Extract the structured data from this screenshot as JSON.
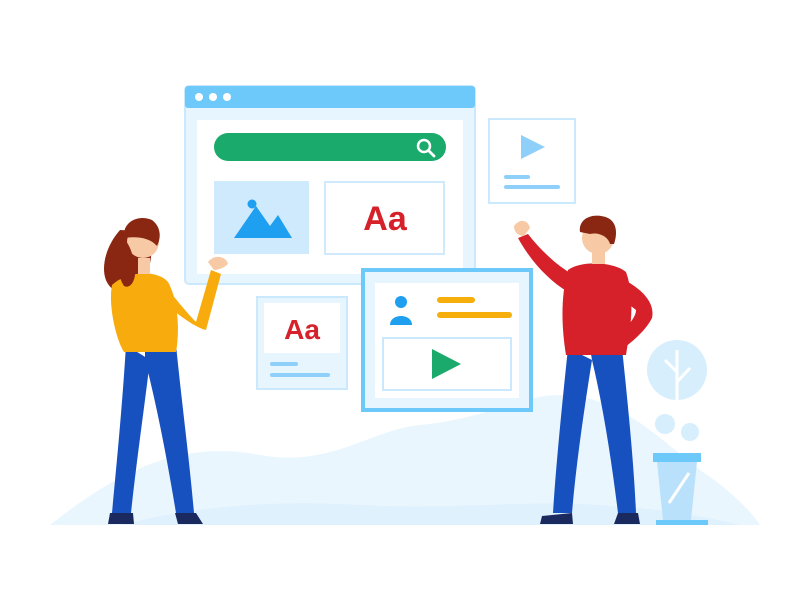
{
  "illustration": {
    "typography_sample_large": "Aa",
    "typography_sample_small": "Aa",
    "icons": [
      "search-icon",
      "image-icon",
      "play-icon",
      "user-icon",
      "plant-icon"
    ],
    "colors": {
      "browser_bar": "#6ec9fb",
      "panel_fill": "#e7f5ff",
      "search_bar": "#1aaa6b",
      "accent_red": "#d6202a",
      "accent_yellow": "#f5ae0c",
      "play_green": "#1aaa6b",
      "play_light": "#8fd0fb",
      "woman_sweater": "#f7ab0c",
      "man_sweater": "#d6202a",
      "pants": "#1751c0",
      "hair": "#8a2712"
    }
  }
}
